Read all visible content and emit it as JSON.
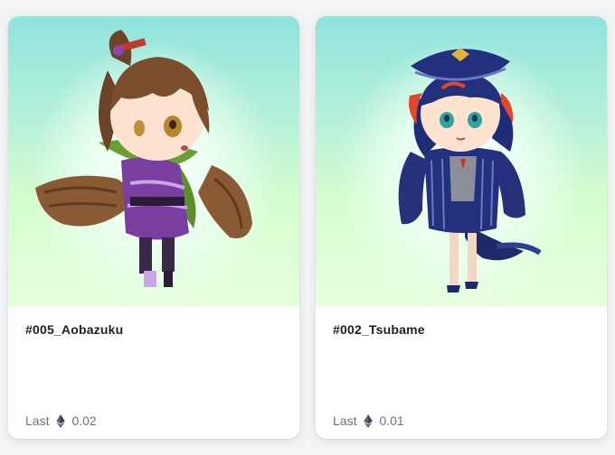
{
  "cards": [
    {
      "name": "#005_Aobazuku",
      "last_label": "Last",
      "currency_icon": "ethereum-icon",
      "price": "0.02"
    },
    {
      "name": "#002_Tsubame",
      "last_label": "Last",
      "currency_icon": "ethereum-icon",
      "price": "0.01"
    }
  ],
  "colors": {
    "card_bg": "#ffffff",
    "page_bg": "#f3f4f6",
    "title_text": "#1c1f26",
    "muted_text": "#6b7280",
    "media_gradient_top": "#8fe3df",
    "media_gradient_bottom": "#e6ffdc"
  }
}
